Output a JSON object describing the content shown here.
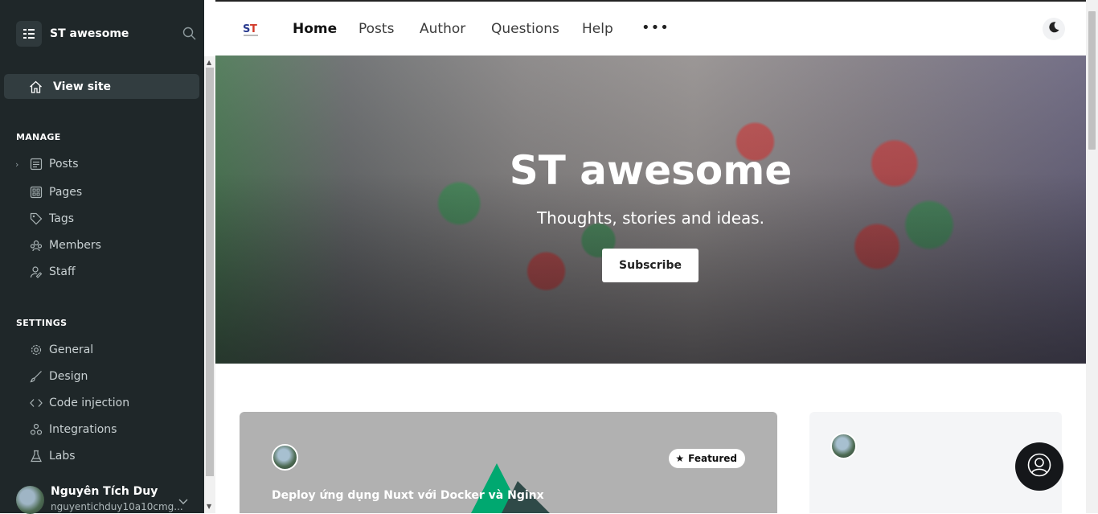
{
  "sidebar": {
    "site_name": "ST awesome",
    "view_site": "View site",
    "manage_title": "MANAGE",
    "manage_items": [
      {
        "label": "Posts",
        "icon": "posts-icon"
      },
      {
        "label": "Pages",
        "icon": "pages-icon"
      },
      {
        "label": "Tags",
        "icon": "tag-icon"
      },
      {
        "label": "Members",
        "icon": "members-icon"
      },
      {
        "label": "Staff",
        "icon": "staff-icon"
      }
    ],
    "settings_title": "SETTINGS",
    "settings_items": [
      {
        "label": "General",
        "icon": "gear-icon"
      },
      {
        "label": "Design",
        "icon": "brush-icon"
      },
      {
        "label": "Code injection",
        "icon": "code-icon"
      },
      {
        "label": "Integrations",
        "icon": "integrations-icon"
      },
      {
        "label": "Labs",
        "icon": "flask-icon"
      }
    ],
    "user": {
      "name": "Nguyên Tích Duy",
      "email": "nguyentichduy10a10cmg..."
    }
  },
  "site": {
    "nav": [
      "Home",
      "Posts",
      "Author",
      "Questions",
      "Help"
    ],
    "more": "•••",
    "hero_title": "ST awesome",
    "hero_description": "Thoughts, stories and ideas.",
    "subscribe": "Subscribe",
    "featured_label": "Featured",
    "featured_post_title": "Deploy ứng dụng Nuxt với Docker và Nginx"
  },
  "colors": {
    "sidebar_bg": "#1f2729",
    "accent": "#15171a"
  }
}
